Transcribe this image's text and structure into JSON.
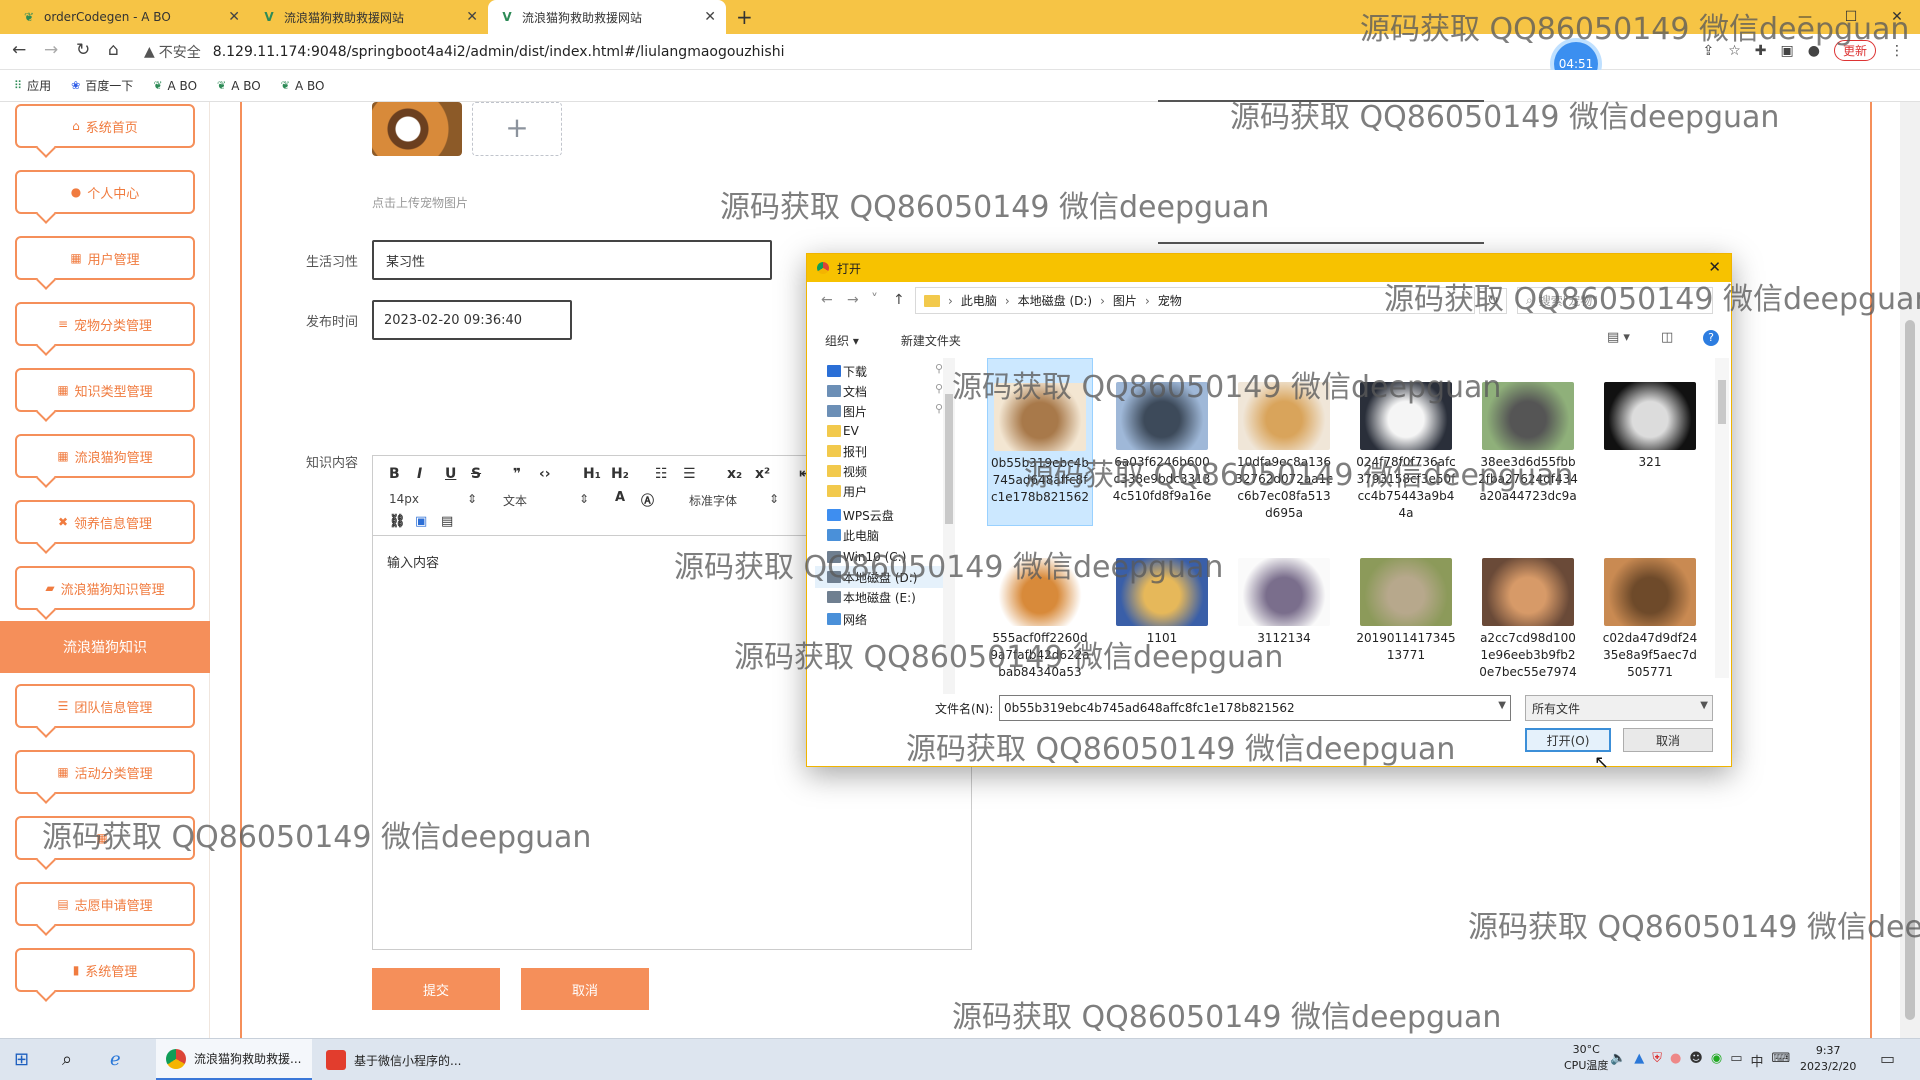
{
  "browser": {
    "tabs": [
      {
        "title": "orderCodegen - A BO",
        "icon": "site-icon"
      },
      {
        "title": "流浪猫狗救助救援网站",
        "icon": "vue-icon"
      },
      {
        "title": "流浪猫狗救助救援网站",
        "icon": "vue-icon",
        "active": true
      }
    ],
    "new_tab": "+",
    "security": "不安全",
    "url": "8.129.11.174:9048/springboot4a4i2/admin/dist/index.html#/liulangmaogouzhishi",
    "timer": "04:51",
    "update_label": "更新",
    "bookmarks": [
      {
        "label": "应用",
        "icon": "apps-icon"
      },
      {
        "label": "百度一下",
        "icon": "baidu-icon"
      },
      {
        "label": "A BO",
        "icon": "site-icon"
      },
      {
        "label": "A BO",
        "icon": "site-icon"
      },
      {
        "label": "A BO",
        "icon": "site-icon"
      }
    ]
  },
  "sidebar": {
    "items": [
      {
        "label": "系统首页",
        "icon": "home-icon"
      },
      {
        "label": "个人中心",
        "icon": "user-icon"
      },
      {
        "label": "用户管理",
        "icon": "grid-icon"
      },
      {
        "label": "宠物分类管理",
        "icon": "list-icon"
      },
      {
        "label": "知识类型管理",
        "icon": "grid-icon"
      },
      {
        "label": "流浪猫狗管理",
        "icon": "grid-icon"
      },
      {
        "label": "领养信息管理",
        "icon": "cross-icon"
      },
      {
        "label": "流浪猫狗知识管理",
        "icon": "book-icon"
      }
    ],
    "active_sub": "流浪猫狗知识",
    "items_after": [
      {
        "label": "团队信息管理",
        "icon": "sliders-icon"
      },
      {
        "label": "活动分类管理",
        "icon": "grid-icon"
      },
      {
        "label": "",
        "icon": "grid-icon"
      },
      {
        "label": "志愿申请管理",
        "icon": "clipboard-icon"
      },
      {
        "label": "系统管理",
        "icon": "bar-chart-icon"
      }
    ]
  },
  "form": {
    "upload_hint": "点击上传宠物图片",
    "habit_label": "生活习性",
    "habit_value": "某习性",
    "publish_label": "发布时间",
    "publish_value": "2023-02-20 09:36:40",
    "content_label": "知识内容",
    "editor": {
      "font_size": "14px",
      "paragraph": "文本",
      "font_family": "标准字体",
      "placeholder": "输入内容"
    },
    "submit_label": "提交",
    "cancel_label": "取消"
  },
  "dialog": {
    "title": "打开",
    "breadcrumb": [
      "此电脑",
      "本地磁盘 (D:)",
      "图片",
      "宠物"
    ],
    "search_placeholder": "搜索\"宠物\"",
    "organize": "组织 ▾",
    "new_folder": "新建文件夹",
    "nav_items": [
      {
        "label": "下载",
        "pinned": true,
        "color": "#2b6fd6"
      },
      {
        "label": "文档",
        "pinned": true,
        "color": "#6c8fb6"
      },
      {
        "label": "图片",
        "pinned": true,
        "color": "#6c8fb6"
      },
      {
        "label": "EV",
        "pinned": false,
        "color": "#f2c94c"
      },
      {
        "label": "报刊",
        "pinned": false,
        "color": "#f2c94c"
      },
      {
        "label": "视频",
        "pinned": false,
        "color": "#f2c94c"
      },
      {
        "label": "用户",
        "pinned": false,
        "color": "#f2c94c"
      },
      {
        "label": "WPS云盘",
        "pinned": false,
        "color": "#3e8ef0"
      },
      {
        "label": "此电脑",
        "pinned": false,
        "color": "#4a90d9"
      },
      {
        "label": "Win10 (C:)",
        "pinned": false,
        "color": "#6f7f90"
      },
      {
        "label": "本地磁盘 (D:)",
        "pinned": false,
        "color": "#6f7f90",
        "selected": true
      },
      {
        "label": "本地磁盘 (E:)",
        "pinned": false,
        "color": "#6f7f90"
      },
      {
        "label": "网络",
        "pinned": false,
        "color": "#4a90d9"
      }
    ],
    "files": [
      {
        "name": "0b55b319ebc4b745ad648affc8fc1e178b821562",
        "selected": true,
        "c1": "#f3e6d2",
        "c2": "#a8794a"
      },
      {
        "name": "6a03f6246b600c338e9bdc33134c510fd8f9a16e",
        "c1": "#9fb8d8",
        "c2": "#3d4a5a"
      },
      {
        "name": "10dfa9ec8a13632762d072aa1cc6b7ec08fa513d695a",
        "c1": "#f0e6d8",
        "c2": "#d9a45b"
      },
      {
        "name": "024f78f0f736afc3793158cf3e50fcc4b75443a9b44a",
        "c1": "#2a2f3a",
        "c2": "#f5f5f5"
      },
      {
        "name": "38ee3d6d55fbb2fba27624df434a20a44723dc9a",
        "c1": "#8fb07a",
        "c2": "#555"
      },
      {
        "name": "321",
        "c1": "#111",
        "c2": "#dcdcdc"
      },
      {
        "name": "555acf0ff2260d9a7fafb42d622abab84340a53",
        "c1": "#fff",
        "c2": "#d88a3a"
      },
      {
        "name": "1101",
        "c1": "#3a5fa8",
        "c2": "#e6b85a"
      },
      {
        "name": "3112134",
        "c1": "#fafafa",
        "c2": "#7a6e8c"
      },
      {
        "name": "201901141734513771",
        "c1": "#8c9a5a",
        "c2": "#b7a88c"
      },
      {
        "name": "a2cc7cd98d1001e96eeb3b9fb20e7bec55e7974",
        "c1": "#6a4a38",
        "c2": "#d79a68"
      },
      {
        "name": "c02da47d9df2435e8a9f5aec7d505771",
        "c1": "#c98a52",
        "c2": "#6e4a2a"
      }
    ],
    "filename_label": "文件名(N):",
    "filename_value": "0b55b319ebc4b745ad648affc8fc1e178b821562",
    "filetype_value": "所有文件",
    "open_label": "打开(O)",
    "cancel_label": "取消"
  },
  "watermark": "源码获取 QQ86050149 微信deepguan",
  "taskbar": {
    "tasks": [
      {
        "label": "流浪猫狗救助救援...",
        "active": true
      },
      {
        "label": "基于微信小程序的...",
        "active": false
      }
    ],
    "temperature": "30°C",
    "temp_label": "CPU温度",
    "ime": "中",
    "time": "9:37",
    "date": "2023/2/20"
  }
}
